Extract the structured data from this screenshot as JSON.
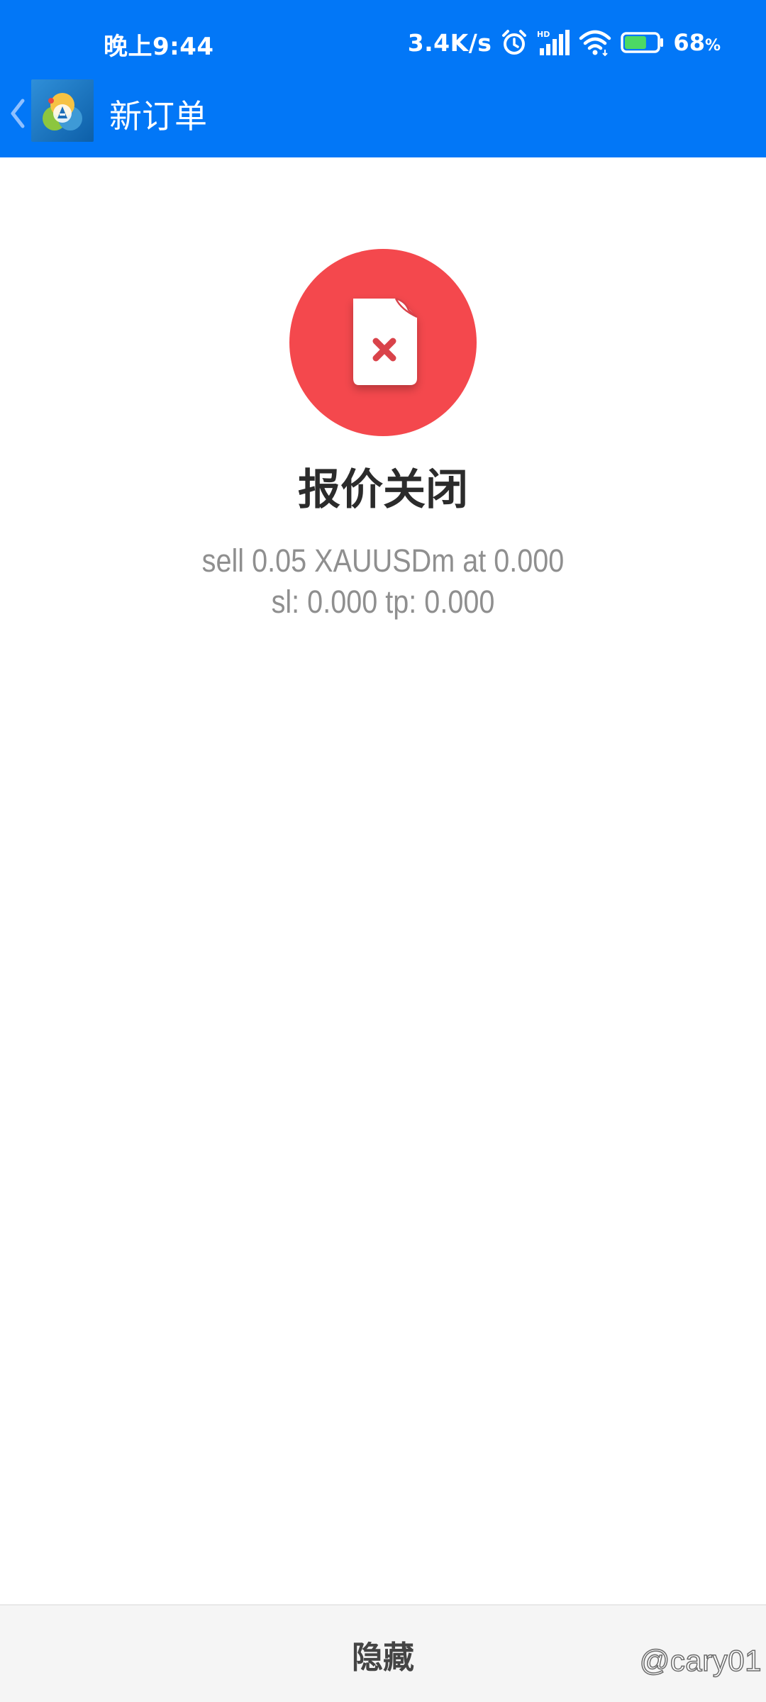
{
  "status_bar": {
    "time": "晚上9:44",
    "network_speed": "3.4K/s",
    "signal_badge": "HD",
    "battery_percent": "68",
    "battery_unit": "%",
    "battery_level": 0.68,
    "icons": [
      "alarm-icon",
      "cellular-signal-icon",
      "wifi-icon",
      "battery-icon"
    ]
  },
  "app_bar": {
    "title": "新订单",
    "icons": [
      "back-chevron-icon",
      "metatrader-logo-icon"
    ]
  },
  "result": {
    "title": "报价关闭",
    "icon": "document-error-icon",
    "details_line1": "sell 0.05 XAUUSDm at 0.000",
    "details_line2": "sl: 0.000 tp: 0.000"
  },
  "bottom_bar": {
    "hide_label": "隐藏"
  },
  "watermark": {
    "text": "@cary01"
  },
  "colors": {
    "header_blue": "#0277f7",
    "error_red": "#f4484d",
    "title_text": "#2b2b2b",
    "detail_text": "#8f8f8f",
    "bottom_bar_bg": "#f5f5f5"
  }
}
